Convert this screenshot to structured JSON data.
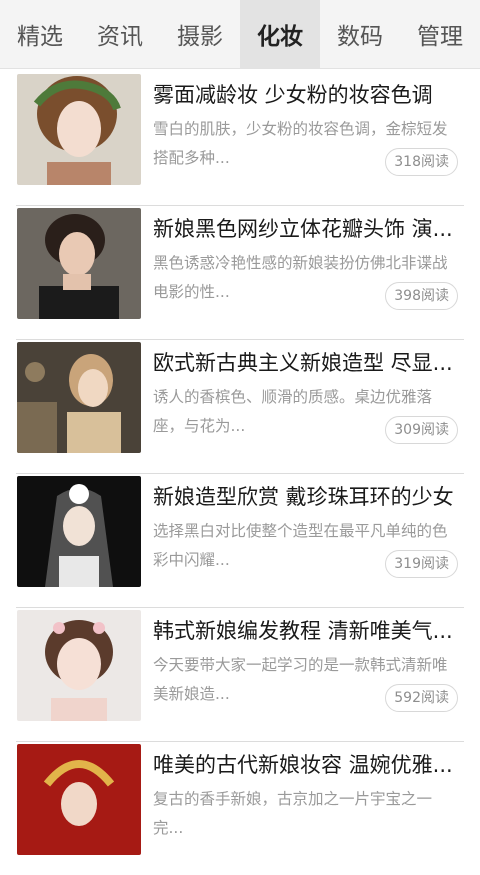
{
  "tabs": [
    {
      "label": "精选"
    },
    {
      "label": "资讯"
    },
    {
      "label": "摄影"
    },
    {
      "label": "化妆",
      "active": true
    },
    {
      "label": "数码"
    },
    {
      "label": "管理"
    }
  ],
  "articles": [
    {
      "title": "雾面减龄妆 少女粉的妆容色调",
      "desc": "雪白的肌肤，少女粉的妆容色调，金棕短发搭配多种...",
      "views": "318阅读"
    },
    {
      "title": "新娘黑色网纱立体花瓣头饰 演...",
      "desc": "黑色诱惑冷艳性感的新娘装扮仿佛北非谍战电影的性...",
      "views": "398阅读"
    },
    {
      "title": "欧式新古典主义新娘造型 尽显...",
      "desc": "诱人的香槟色、顺滑的质感。桌边优雅落座，与花为...",
      "views": "309阅读"
    },
    {
      "title": "新娘造型欣赏 戴珍珠耳环的少女",
      "desc": "选择黑白对比使整个造型在最平凡单纯的色彩中闪耀...",
      "views": "319阅读"
    },
    {
      "title": "韩式新娘编发教程 清新唯美气...",
      "desc": "今天要带大家一起学习的是一款韩式清新唯美新娘造...",
      "views": "592阅读"
    },
    {
      "title": "唯美的古代新娘妆容 温婉优雅...",
      "desc": "复古的香手新娘，古京加之一片宇宝之一完...",
      "views": ""
    }
  ]
}
